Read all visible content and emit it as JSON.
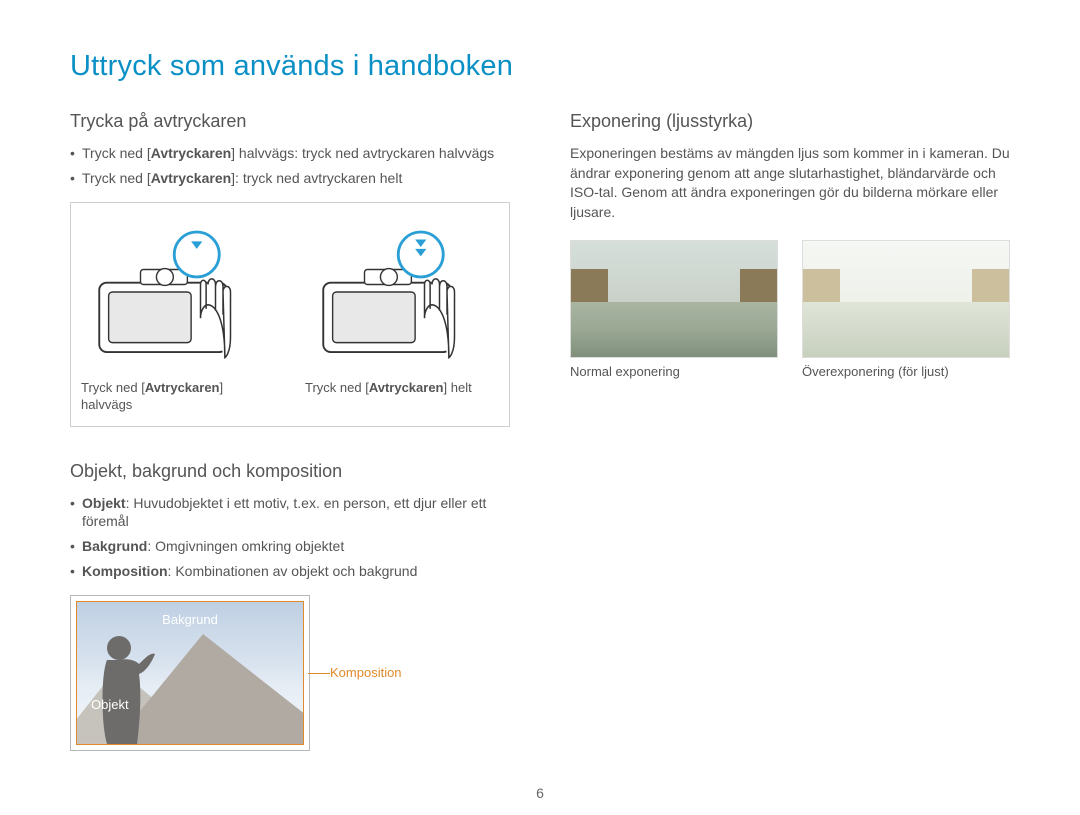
{
  "pageTitle": "Uttryck som används i handboken",
  "pageNumber": "6",
  "left": {
    "shutter": {
      "heading": "Trycka på avtryckaren",
      "bullets": [
        {
          "pre": "Tryck ned [",
          "bold": "Avtryckaren",
          "post": "] halvvägs: tryck ned avtryckaren halvvägs"
        },
        {
          "pre": "Tryck ned [",
          "bold": "Avtryckaren",
          "post": "]: tryck ned avtryckaren helt"
        }
      ],
      "captions": [
        {
          "pre": "Tryck ned [",
          "bold": "Avtryckaren",
          "post": "] halvvägs"
        },
        {
          "pre": "Tryck ned [",
          "bold": "Avtryckaren",
          "post": "] helt"
        }
      ]
    },
    "composition": {
      "heading": "Objekt, bakgrund och komposition",
      "bullets": [
        {
          "bold": "Objekt",
          "post": ": Huvudobjektet i ett motiv, t.ex. en person, ett djur eller ett föremål"
        },
        {
          "bold": "Bakgrund",
          "post": ": Omgivningen omkring objektet"
        },
        {
          "bold": "Komposition",
          "post": ": Kombinationen av objekt och bakgrund"
        }
      ],
      "labels": {
        "bakgrund": "Bakgrund",
        "objekt": "Objekt",
        "komposition": "Komposition"
      }
    }
  },
  "right": {
    "exposure": {
      "heading": "Exponering (ljusstyrka)",
      "para": "Exponeringen bestäms av mängden ljus som kommer in i kameran. Du ändrar exponering genom att ange slutarhastighet, bländarvärde och ISO-tal. Genom att ändra exponeringen gör du bilderna mörkare eller ljusare.",
      "captions": [
        "Normal exponering",
        "Överexponering (för ljust)"
      ]
    }
  }
}
